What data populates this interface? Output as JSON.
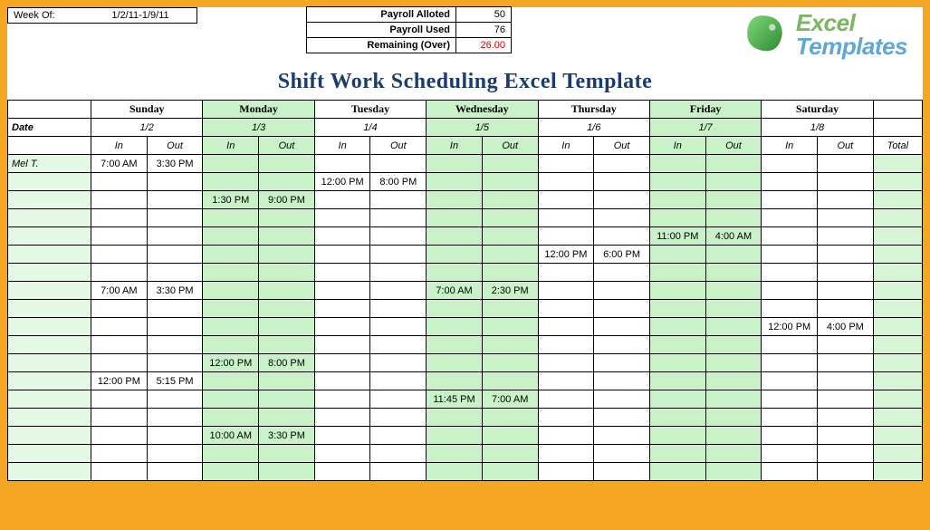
{
  "meta": {
    "weekOfLabel": "Week Of:",
    "weekOf": "1/2/11-1/9/11",
    "payrollAllotedLabel": "Payroll Alloted",
    "payrollAlloted": "50",
    "payrollUsedLabel": "Payroll Used",
    "payrollUsed": "76",
    "remainingLabel": "Remaining (Over)",
    "remaining": "26.00"
  },
  "title": "Shift Work Scheduling Excel Template",
  "logo": {
    "excel": "Excel",
    "templates": "Templates"
  },
  "days": [
    "Sunday",
    "Monday",
    "Tuesday",
    "Wednesday",
    "Thursday",
    "Friday",
    "Saturday"
  ],
  "dates": [
    "1/2",
    "1/3",
    "1/4",
    "1/5",
    "1/6",
    "1/7",
    "1/8"
  ],
  "labels": {
    "date": "Date",
    "in": "In",
    "out": "Out",
    "total": "Total"
  },
  "rows": [
    {
      "name": "Mel T.",
      "cells": [
        "7:00 AM",
        "3:30 PM",
        "",
        "",
        "",
        "",
        "",
        "",
        "",
        "",
        "",
        "",
        "",
        ""
      ],
      "total": ""
    },
    {
      "name": "",
      "cells": [
        "",
        "",
        "",
        "",
        "12:00 PM",
        "8:00 PM",
        "",
        "",
        "",
        "",
        "",
        "",
        "",
        ""
      ],
      "total": ""
    },
    {
      "name": "",
      "cells": [
        "",
        "",
        "1:30 PM",
        "9:00 PM",
        "",
        "",
        "",
        "",
        "",
        "",
        "",
        "",
        "",
        ""
      ],
      "total": ""
    },
    {
      "name": "",
      "cells": [
        "",
        "",
        "",
        "",
        "",
        "",
        "",
        "",
        "",
        "",
        "",
        "",
        "",
        ""
      ],
      "total": ""
    },
    {
      "name": "",
      "cells": [
        "",
        "",
        "",
        "",
        "",
        "",
        "",
        "",
        "",
        "",
        "11:00 PM",
        "4:00 AM",
        "",
        ""
      ],
      "total": ""
    },
    {
      "name": "",
      "cells": [
        "",
        "",
        "",
        "",
        "",
        "",
        "",
        "",
        "12:00 PM",
        "6:00 PM",
        "",
        "",
        "",
        ""
      ],
      "total": ""
    },
    {
      "name": "",
      "cells": [
        "",
        "",
        "",
        "",
        "",
        "",
        "",
        "",
        "",
        "",
        "",
        "",
        "",
        ""
      ],
      "total": ""
    },
    {
      "name": "",
      "cells": [
        "7:00 AM",
        "3:30 PM",
        "",
        "",
        "",
        "",
        "7:00 AM",
        "2:30 PM",
        "",
        "",
        "",
        "",
        "",
        ""
      ],
      "total": ""
    },
    {
      "name": "",
      "cells": [
        "",
        "",
        "",
        "",
        "",
        "",
        "",
        "",
        "",
        "",
        "",
        "",
        "",
        ""
      ],
      "total": ""
    },
    {
      "name": "",
      "cells": [
        "",
        "",
        "",
        "",
        "",
        "",
        "",
        "",
        "",
        "",
        "",
        "",
        "12:00 PM",
        "4:00 PM"
      ],
      "total": ""
    },
    {
      "name": "",
      "cells": [
        "",
        "",
        "",
        "",
        "",
        "",
        "",
        "",
        "",
        "",
        "",
        "",
        "",
        ""
      ],
      "total": ""
    },
    {
      "name": "",
      "cells": [
        "",
        "",
        "12:00 PM",
        "8:00 PM",
        "",
        "",
        "",
        "",
        "",
        "",
        "",
        "",
        "",
        ""
      ],
      "total": ""
    },
    {
      "name": "",
      "cells": [
        "12:00 PM",
        "5:15 PM",
        "",
        "",
        "",
        "",
        "",
        "",
        "",
        "",
        "",
        "",
        "",
        ""
      ],
      "total": ""
    },
    {
      "name": "",
      "cells": [
        "",
        "",
        "",
        "",
        "",
        "",
        "11:45 PM",
        "7:00 AM",
        "",
        "",
        "",
        "",
        "",
        ""
      ],
      "total": ""
    },
    {
      "name": "",
      "cells": [
        "",
        "",
        "",
        "",
        "",
        "",
        "",
        "",
        "",
        "",
        "",
        "",
        "",
        ""
      ],
      "total": ""
    },
    {
      "name": "",
      "cells": [
        "",
        "",
        "10:00 AM",
        "3:30 PM",
        "",
        "",
        "",
        "",
        "",
        "",
        "",
        "",
        "",
        ""
      ],
      "total": ""
    },
    {
      "name": "",
      "cells": [
        "",
        "",
        "",
        "",
        "",
        "",
        "",
        "",
        "",
        "",
        "",
        "",
        "",
        ""
      ],
      "total": ""
    },
    {
      "name": "",
      "cells": [
        "",
        "",
        "",
        "",
        "",
        "",
        "",
        "",
        "",
        "",
        "",
        "",
        "",
        ""
      ],
      "total": ""
    }
  ]
}
